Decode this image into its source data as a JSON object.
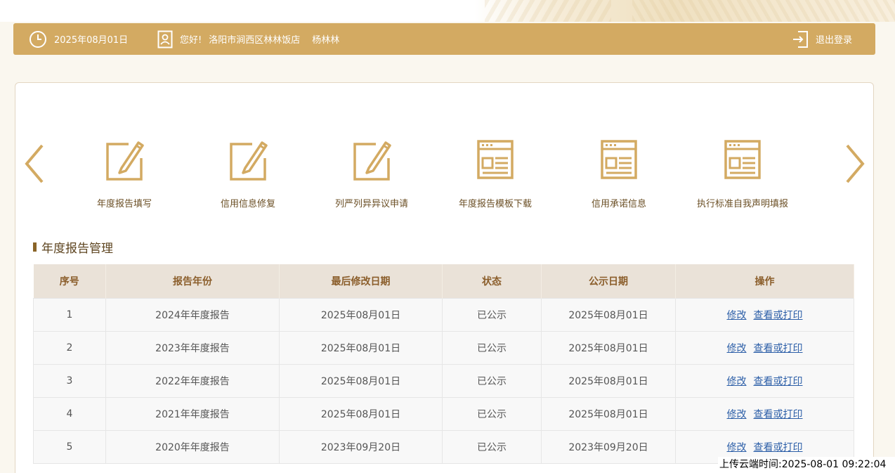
{
  "header": {
    "date": "2025年08月01日",
    "greeting": "您好!",
    "company": "洛阳市涧西区林林饭店",
    "user": "杨林林",
    "logout_label": "退出登录",
    "bar_color": "#d3aa62"
  },
  "quick_links": [
    {
      "label": "年度报告填写",
      "icon": "edit-icon"
    },
    {
      "label": "信用信息修复",
      "icon": "edit-icon"
    },
    {
      "label": "列严列异异议申请",
      "icon": "edit-icon"
    },
    {
      "label": "年度报告模板下载",
      "icon": "document-window-icon"
    },
    {
      "label": "信用承诺信息",
      "icon": "document-window-icon"
    },
    {
      "label": "执行标准自我声明填报",
      "icon": "document-window-icon"
    }
  ],
  "section": {
    "title": "年度报告管理"
  },
  "table": {
    "headers": [
      "序号",
      "报告年份",
      "最后修改日期",
      "状态",
      "公示日期",
      "操作"
    ],
    "rows": [
      {
        "index": "1",
        "year": "2024年年度报告",
        "modified": "2025年08月01日",
        "status": "已公示",
        "published": "2025年08月01日",
        "edit": "修改",
        "view": "查看或打印"
      },
      {
        "index": "2",
        "year": "2023年年度报告",
        "modified": "2025年08月01日",
        "status": "已公示",
        "published": "2025年08月01日",
        "edit": "修改",
        "view": "查看或打印"
      },
      {
        "index": "3",
        "year": "2022年年度报告",
        "modified": "2025年08月01日",
        "status": "已公示",
        "published": "2025年08月01日",
        "edit": "修改",
        "view": "查看或打印"
      },
      {
        "index": "4",
        "year": "2021年年度报告",
        "modified": "2025年08月01日",
        "status": "已公示",
        "published": "2025年08月01日",
        "edit": "修改",
        "view": "查看或打印"
      },
      {
        "index": "5",
        "year": "2020年年度报告",
        "modified": "2023年09月20日",
        "status": "已公示",
        "published": "2023年09月20日",
        "edit": "修改",
        "view": "查看或打印"
      }
    ]
  },
  "watermark": "上传云端时间:2025-08-01 09:22:04",
  "colors": {
    "accent": "#d3aa62",
    "link": "#2d5fa8",
    "header_text": "#8b5e2b"
  }
}
